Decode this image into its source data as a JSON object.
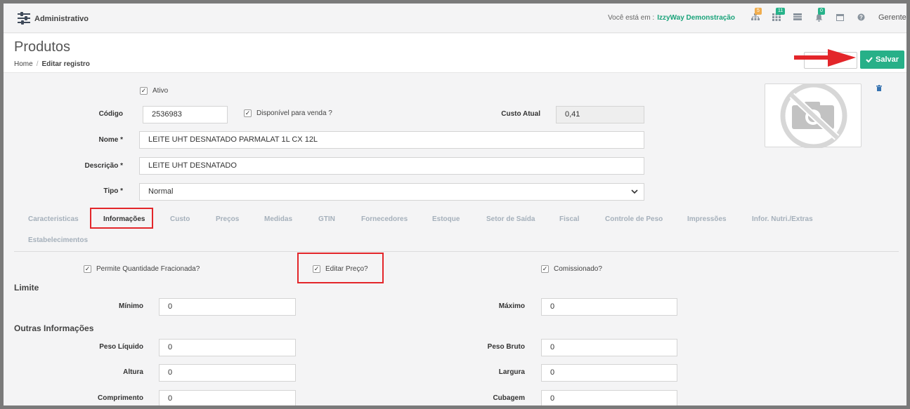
{
  "header": {
    "app_title": "Administrativo",
    "here_label": "Você está em :",
    "company": "IzzyWay Demonstração",
    "badges": {
      "sitemap": "5",
      "grid": "11",
      "bell": "0"
    },
    "user": "Gerente"
  },
  "page": {
    "title": "Produtos",
    "breadcrumb": {
      "home": "Home",
      "current": "Editar registro"
    },
    "back_label": "",
    "save_label": "Salvar"
  },
  "form": {
    "ativo_label": "Ativo",
    "codigo_label": "Código",
    "codigo_value": "2536983",
    "disponivel_label": "Disponível para venda ?",
    "custo_label": "Custo Atual",
    "custo_value": "0,41",
    "nome_label": "Nome *",
    "nome_value": "LEITE UHT DESNATADO PARMALAT 1L CX 12L",
    "descricao_label": "Descrição *",
    "descricao_value": "LEITE UHT DESNATADO",
    "tipo_label": "Tipo *",
    "tipo_value": "Normal"
  },
  "tabs": [
    "Caracteristicas",
    "Informações",
    "Custo",
    "Preços",
    "Medidas",
    "GTIN",
    "Fornecedores",
    "Estoque",
    "Setor de Saída",
    "Fiscal",
    "Controle de Peso",
    "Impressões",
    "Infor. Nutri./Extras",
    "Estabelecimentos"
  ],
  "info": {
    "fracionada_label": "Permite Quantidade Fracionada?",
    "editar_preco_label": "Editar Preço?",
    "comissionado_label": "Comissionado?",
    "limite_title": "Limite",
    "minimo_label": "Mínimo",
    "minimo_value": "0",
    "maximo_label": "Máximo",
    "maximo_value": "0",
    "outras_title": "Outras Informações",
    "peso_liquido_label": "Peso Líquido",
    "peso_liquido_value": "0",
    "peso_bruto_label": "Peso Bruto",
    "peso_bruto_value": "0",
    "altura_label": "Altura",
    "altura_value": "0",
    "largura_label": "Largura",
    "largura_value": "0",
    "comprimento_label": "Comprimento",
    "comprimento_value": "0",
    "cubagem_label": "Cubagem",
    "cubagem_value": "0"
  },
  "colors": {
    "accent": "#27b088",
    "annotation": "#e3262a",
    "company": "#1aa37a"
  }
}
